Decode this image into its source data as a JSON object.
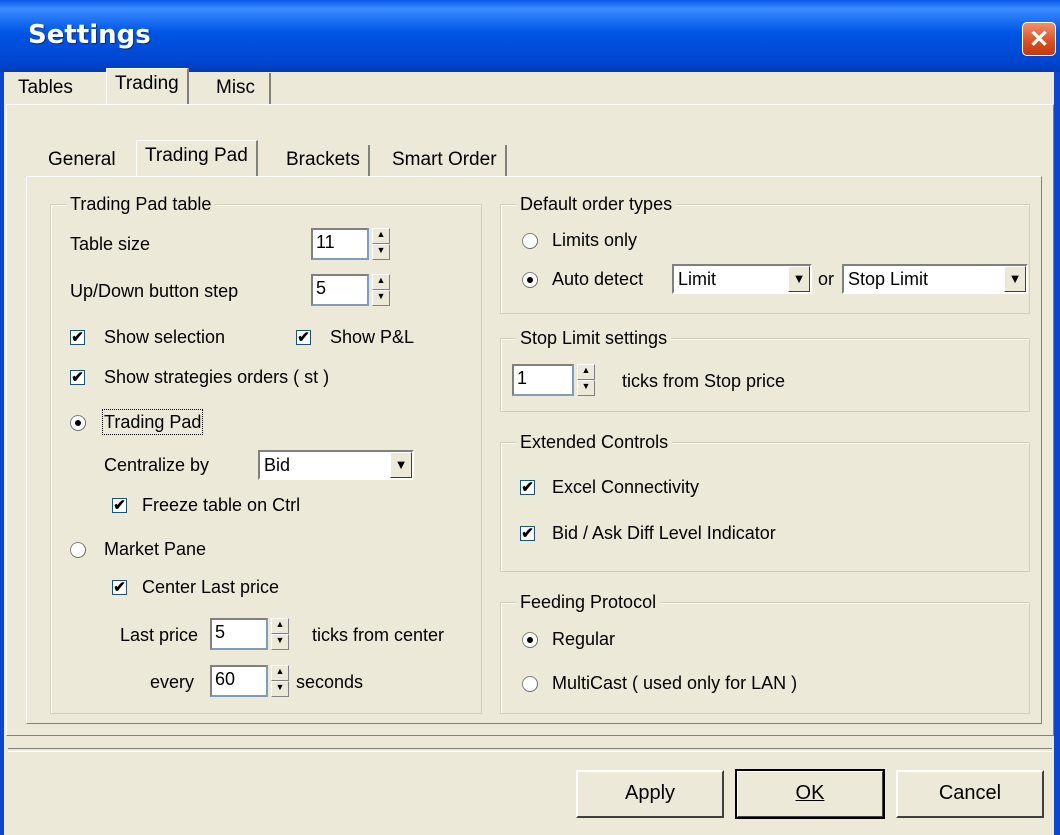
{
  "window": {
    "title": "Settings",
    "close_glyph": "✕"
  },
  "main_tabs": [
    "Tables",
    "Trading",
    "Misc"
  ],
  "sub_tabs": [
    "General",
    "Trading Pad",
    "Brackets",
    "Smart Order"
  ],
  "trading_pad_table": {
    "legend": "Trading Pad table",
    "table_size_label": "Table size",
    "table_size_value": "11",
    "updown_label": "Up/Down button step",
    "updown_value": "5",
    "show_selection": "Show selection",
    "show_pl": "Show P&L",
    "show_strategies": "Show strategies orders ( st )",
    "trading_pad_radio": "Trading Pad",
    "centralize_label": "Centralize by",
    "centralize_value": "Bid",
    "freeze_table": "Freeze table on Ctrl",
    "market_pane_radio": "Market Pane",
    "center_last_price": "Center Last price",
    "last_price_label": "Last price",
    "last_price_value": "5",
    "ticks_from_center": "ticks from center",
    "every_label": "every",
    "every_value": "60",
    "seconds_label": "seconds"
  },
  "default_order_types": {
    "legend": "Default order types",
    "limits_only": "Limits only",
    "auto_detect": "Auto detect",
    "combo1_value": "Limit",
    "or_label": "or",
    "combo2_value": "Stop Limit"
  },
  "stop_limit_settings": {
    "legend": "Stop Limit settings",
    "ticks_value": "1",
    "ticks_label": "ticks from Stop price"
  },
  "extended_controls": {
    "legend": "Extended Controls",
    "excel": "Excel Connectivity",
    "bidask": "Bid / Ask Diff Level Indicator"
  },
  "feeding_protocol": {
    "legend": "Feeding Protocol",
    "regular": "Regular",
    "multicast": "MultiCast ( used only for LAN )"
  },
  "buttons": {
    "apply": "Apply",
    "ok": "OK",
    "cancel": "Cancel"
  },
  "glyphs": {
    "check": "✔",
    "dropdown": "▼",
    "spin_up": "▲",
    "spin_down": "▼"
  }
}
